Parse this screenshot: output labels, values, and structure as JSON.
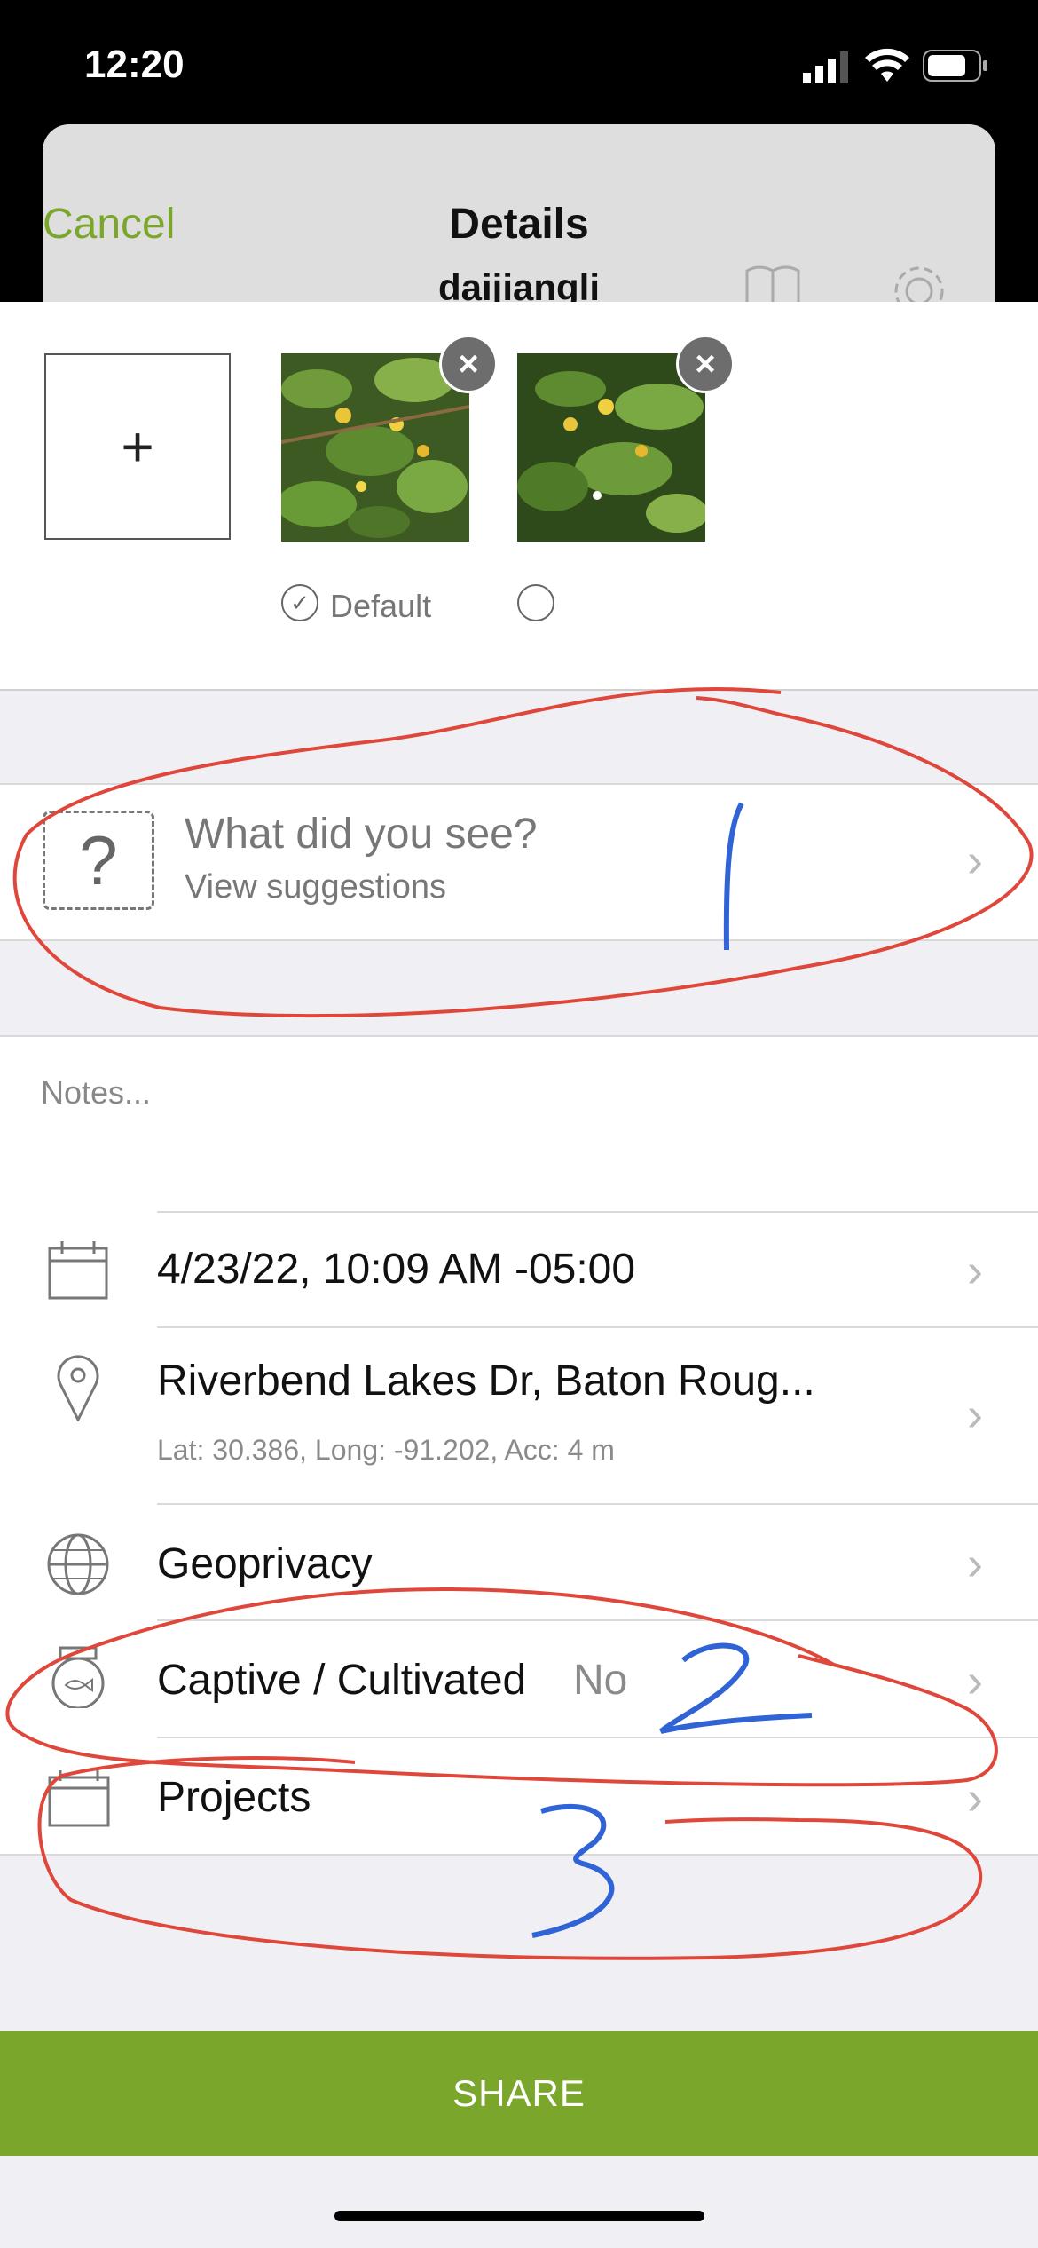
{
  "status": {
    "time": "12:20"
  },
  "header": {
    "cancel": "Cancel",
    "title": "Details",
    "user": "daijiangli"
  },
  "photos": {
    "add": "+",
    "remove": "×",
    "default_label": "Default"
  },
  "species": {
    "title": "What did you see?",
    "subtitle": "View suggestions",
    "icon": "?"
  },
  "notes": {
    "placeholder": "Notes..."
  },
  "fields": {
    "date": "4/23/22, 10:09 AM -05:00",
    "location": "Riverbend Lakes Dr, Baton Roug...",
    "coords": "Lat: 30.386, Long: -91.202, Acc: 4 m",
    "geoprivacy": "Geoprivacy",
    "captive": "Captive / Cultivated",
    "captive_value": "No",
    "projects": "Projects"
  },
  "share": "SHARE",
  "colors": {
    "accent": "#7ba62c",
    "annotation_red": "#e0473b",
    "annotation_blue": "#2f63d6"
  }
}
